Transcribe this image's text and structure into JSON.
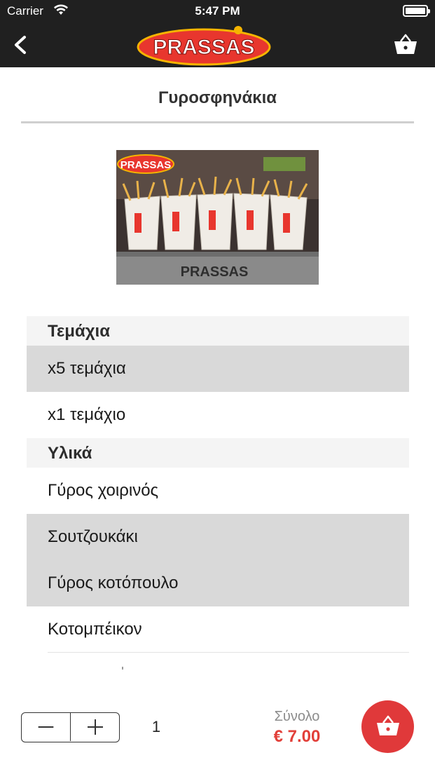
{
  "status_bar": {
    "carrier": "Carrier",
    "time": "5:47 PM"
  },
  "nav": {
    "logo_text": "PRASSAS",
    "back_icon": "chevron-left-icon",
    "cart_icon": "basket-icon"
  },
  "page": {
    "title": "Γυροσφηνάκια"
  },
  "image": {
    "logo_text": "PRASSAS",
    "stand_text": "PRASSAS"
  },
  "sections": [
    {
      "title": "Τεμάχια",
      "options": [
        {
          "label": "x5 τεμάχια",
          "selected": true
        },
        {
          "label": "x1 τεμάχιο",
          "selected": false
        }
      ]
    },
    {
      "title": "Υλικά",
      "options": [
        {
          "label": "Γύρος χοιρινός",
          "selected": false
        },
        {
          "label": "Σουτζουκάκι",
          "selected": true
        },
        {
          "label": "Γύρος κοτόπουλο",
          "selected": true
        },
        {
          "label": "Κοτομπέικον",
          "selected": false
        }
      ]
    }
  ],
  "bottom": {
    "quantity": "1",
    "total_label": "Σύνολο",
    "total_value": "€ 7.00",
    "accent": "#e0393a"
  }
}
